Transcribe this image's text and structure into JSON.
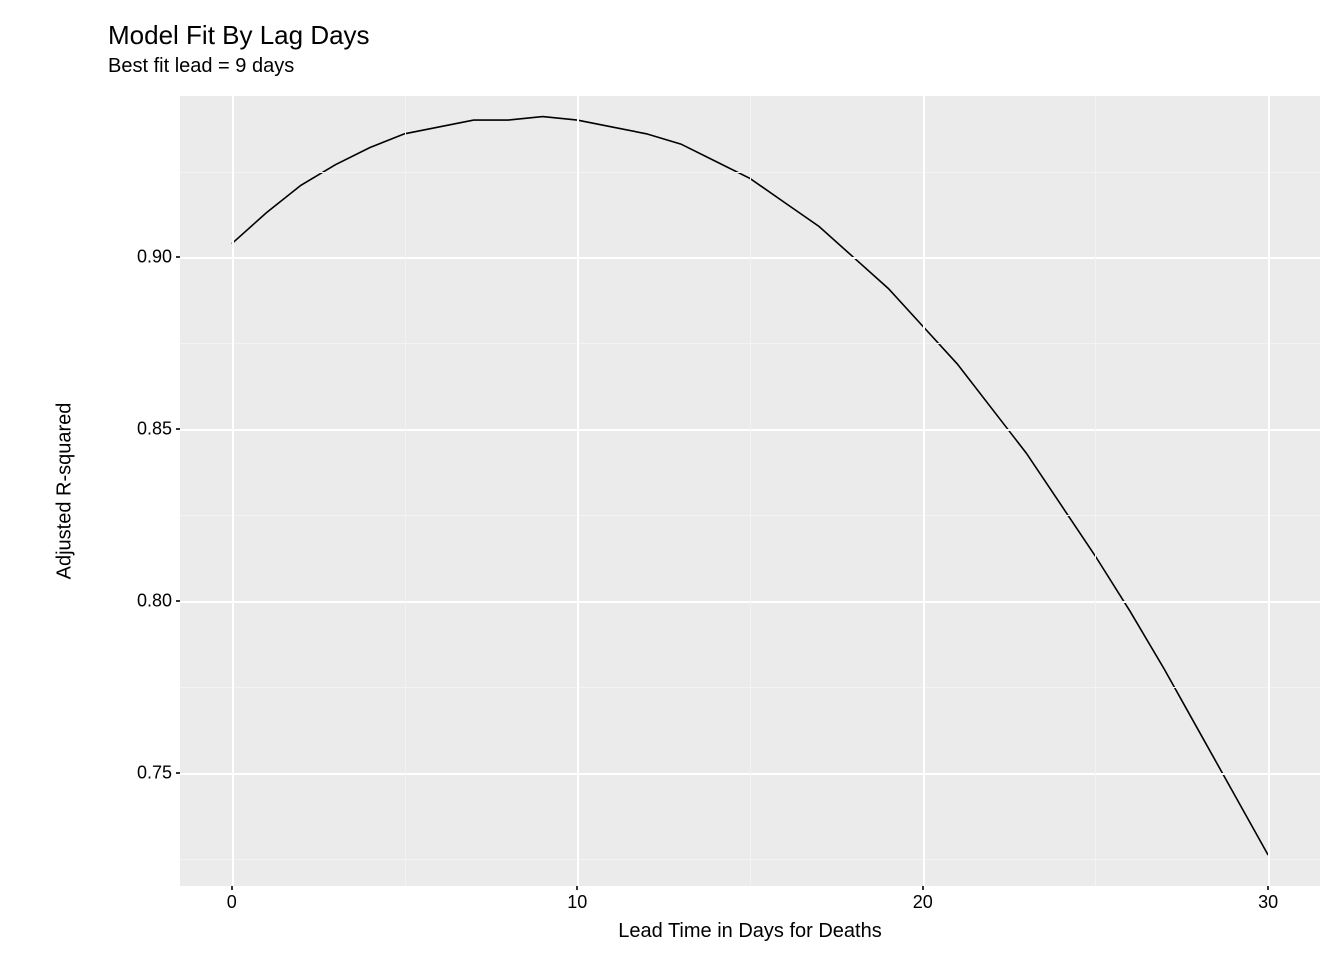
{
  "chart_data": {
    "type": "line",
    "title": "Model Fit By Lag Days",
    "subtitle": "Best fit lead = 9 days",
    "xlabel": "Lead Time in Days for Deaths",
    "ylabel": "Adjusted R-squared",
    "x_ticks": [
      0,
      10,
      20,
      30
    ],
    "y_ticks": [
      0.75,
      0.8,
      0.85,
      0.9
    ],
    "y_tick_labels": [
      "0.75",
      "0.80",
      "0.85",
      "0.90"
    ],
    "xlim": [
      -1.5,
      31.5
    ],
    "ylim": [
      0.717,
      0.947
    ],
    "series": [
      {
        "name": "Adjusted R-squared",
        "x": [
          0,
          1,
          2,
          3,
          4,
          5,
          6,
          7,
          8,
          9,
          10,
          11,
          12,
          13,
          14,
          15,
          16,
          17,
          18,
          19,
          20,
          21,
          22,
          23,
          24,
          25,
          26,
          27,
          28,
          29,
          30
        ],
        "values": [
          0.904,
          0.913,
          0.921,
          0.927,
          0.932,
          0.936,
          0.938,
          0.94,
          0.94,
          0.941,
          0.94,
          0.938,
          0.936,
          0.933,
          0.928,
          0.923,
          0.916,
          0.909,
          0.9,
          0.891,
          0.88,
          0.869,
          0.856,
          0.843,
          0.828,
          0.813,
          0.797,
          0.78,
          0.762,
          0.744,
          0.726
        ]
      }
    ]
  }
}
